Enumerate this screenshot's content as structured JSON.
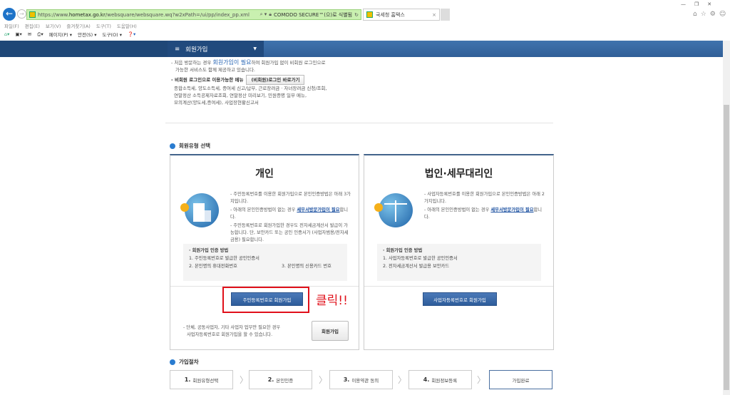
{
  "browser": {
    "url_scheme": "https://www.",
    "url_domain": "hometax.go.kr",
    "url_path": "/websquare/websquare.wq?w2xPath=/ui/pp/index_pp.xml",
    "security": "COMODO SECURE™(으)로 식별됨",
    "tab_title": "국세청 홈택스",
    "menu": [
      "파일(F)",
      "편집(E)",
      "보기(V)",
      "즐겨찾기(A)",
      "도구(T)",
      "도움말(H)"
    ],
    "toolbar": [
      "페이지(P) ▾",
      "안전(S) ▾",
      "도구(O) ▾"
    ]
  },
  "nav": {
    "menu_label": "회원가입"
  },
  "intro": {
    "line1a": "- 처음 방문하는 경우 ",
    "line1_hl": "회원가입이 필요",
    "line1b": "하여 회원가입 없이 비회원 로그인으로",
    "line2": "가능한 서비스도 함께 제공하고 있습니다.",
    "nonmember_label": "- 비회원 로그인으로 이용가능한 메뉴",
    "nonmember_btn": "(비회원)로그인 바로가기",
    "list1": "종합소득세, 양도소득세, 증여세 신고/납부, 근로장려금 · 자녀장려금 신청/조회,",
    "list2": "연말정산 소득공제자료조회, 연말정산 미리보기, 민원증명 일부 메뉴,",
    "list3": "모의계산(양도세,증여세), 사업장현황신고서"
  },
  "section_type": "회원유형 선택",
  "personal": {
    "title": "개인",
    "d1": "- 주민등록번호를 이용한 회원가입으로 본인인증방법은 아래 3가지입니다.",
    "d2a": "- 아래의 본인인증방법이 없는 경우 ",
    "d2_link": "세무서방문가입이 필요",
    "d2b": "합니다.",
    "d3": "- 주민등록번호로 회원가입한 경우도 전자세금계산서 발급이 가능합니다. 단, 보안카드 또는 공인 인증서가 (사업자범용/전자세금용) 필요합니다.",
    "method_title": "· 회원가입 인증 방법",
    "m1": "1. 주민등록번호로 발급한 공인인증서",
    "m2": "2. 본인명의 휴대전화번호",
    "m3": "3. 본인명의 신용카드 번호",
    "signup_btn": "주민등록번호로 회원가입",
    "note1": "- 단체, 공동사업자, 기타 사업자 업무만 필요한 경우",
    "note2": "사업자등록번호로 회원가입을 할 수 있습니다.",
    "join_btn": "회원가입"
  },
  "annotation": "클릭!!",
  "corporate": {
    "title": "법인·세무대리인",
    "d1": "- 사업자등록번호를 이용한 회원가입으로 본인인증방법은 아래 2가지입니다.",
    "d2a": "- 아래의 본인인증방법이 없는 경우 ",
    "d2_link": "세무서방문가입이 필요",
    "d2b": "합니다.",
    "method_title": "· 회원가입 인증 방법",
    "m1": "1. 사업자등록번호로 발급한 공인인증서",
    "m2": "2. 전자세금계산서 발급용 보안카드",
    "signup_btn": "사업자등록번호로 회원가입"
  },
  "section_steps": "가입절차",
  "steps": [
    {
      "num": "1.",
      "label": "회원유형선택"
    },
    {
      "num": "2.",
      "label": "본인인증"
    },
    {
      "num": "3.",
      "label": "이용약관 동의"
    },
    {
      "num": "4.",
      "label": "회원정보등록"
    },
    {
      "num": "",
      "label": "가입완료"
    }
  ]
}
